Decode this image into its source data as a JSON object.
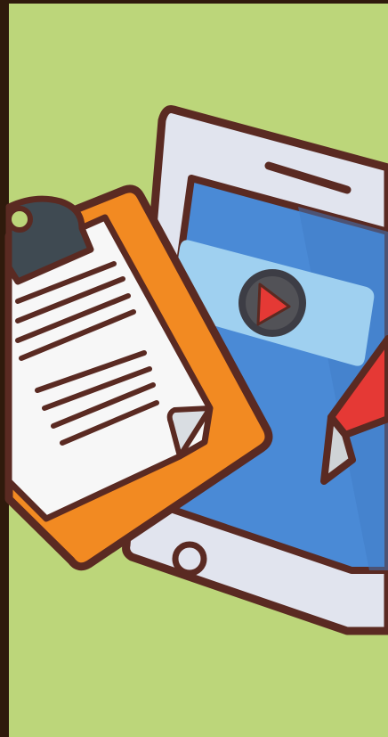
{
  "illustration": {
    "subject": [
      "clipboard-icon",
      "smartphone-icon",
      "video-play-icon",
      "pencil-icon"
    ],
    "colors": {
      "frame": "#2f1a0c",
      "background": "#bcd67a",
      "outline": "#5a2a22",
      "phone_body": "#e1e4ee",
      "screen": "#4a8ad6",
      "video_card": "#9fd0f0",
      "play_button": "#3d3d45",
      "play_triangle": "#e53935",
      "clipboard": "#f28a22",
      "clip": "#3f4a52",
      "paper": "#f7f7f7",
      "pencil": "#e53935",
      "pencil_tip": "#cfd3d6"
    }
  }
}
